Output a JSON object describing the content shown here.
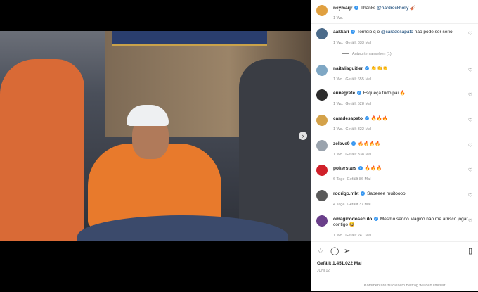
{
  "post": {
    "author": "neymarjr",
    "caption": "Thanks",
    "caption_mention": "@hardrockholly",
    "caption_emoji": "🎻",
    "age": "1 Wo."
  },
  "comments": [
    {
      "user": "aakkari",
      "verified": true,
      "text_before": "Torneio q o ",
      "mention": "@caradesapato",
      "text_after": " nao pode ser serio!",
      "age": "1 Wo.",
      "likes": "Gefällt 833 Mal",
      "replies": "Antworten ansehen (1)",
      "avatar_color": "#4b6b8a"
    },
    {
      "user": "naitaliaguitler",
      "verified": true,
      "text_before": "",
      "mention": "",
      "text_after": "👏👏👏",
      "age": "1 Wo.",
      "likes": "Gefällt 655 Mal",
      "avatar_color": "#7fa7c4"
    },
    {
      "user": "eunegrete",
      "verified": true,
      "text_before": "Esqueça tudo pai ",
      "mention": "",
      "text_after": "🔥",
      "age": "1 Wo.",
      "likes": "Gefällt 528 Mal",
      "avatar_color": "#2d2d2d"
    },
    {
      "user": "caradesapato",
      "verified": true,
      "text_before": "",
      "mention": "",
      "text_after": "🔥🔥🔥",
      "age": "1 Wo.",
      "likes": "Gefällt 322 Mal",
      "avatar_color": "#d4a24a"
    },
    {
      "user": "zelove9",
      "verified": true,
      "text_before": "",
      "mention": "",
      "text_after": "🔥🔥🔥🔥",
      "age": "1 Wo.",
      "likes": "Gefällt 338 Mal",
      "avatar_color": "#9aa3ad"
    },
    {
      "user": "pokerstars",
      "verified": true,
      "text_before": "",
      "mention": "",
      "text_after": "🔥🔥🔥",
      "age": "6 Tage",
      "likes": "Gefällt 86 Mal",
      "avatar_color": "#d0202a"
    },
    {
      "user": "rodrigo.mbt",
      "verified": true,
      "text_before": "Sabeeee muitoooo",
      "mention": "",
      "text_after": "",
      "age": "4 Tage",
      "likes": "Gefällt 37 Mal",
      "avatar_color": "#5a5a5a"
    },
    {
      "user": "omagicodoseculo",
      "verified": true,
      "text_before": "Mesmo sendo Mágico não me arrisco jogar contigo ",
      "mention": "",
      "text_after": "😆",
      "age": "1 Wo.",
      "likes": "Gefällt 241 Mal",
      "avatar_color": "#6a3f8a"
    }
  ],
  "actions": {
    "like_icon": "heart-outline-icon",
    "comment_icon": "comment-icon",
    "share_icon": "share-icon",
    "save_icon": "bookmark-icon",
    "likes_total": "Gefällt 1.451.022 Mal",
    "date": "Juni 12",
    "comments_disabled": "Kommentare zu diesem Beitrag wurden limitiert."
  },
  "colors": {
    "accent": "#3897f0",
    "text": "#262626",
    "muted": "#8e8e8e"
  }
}
